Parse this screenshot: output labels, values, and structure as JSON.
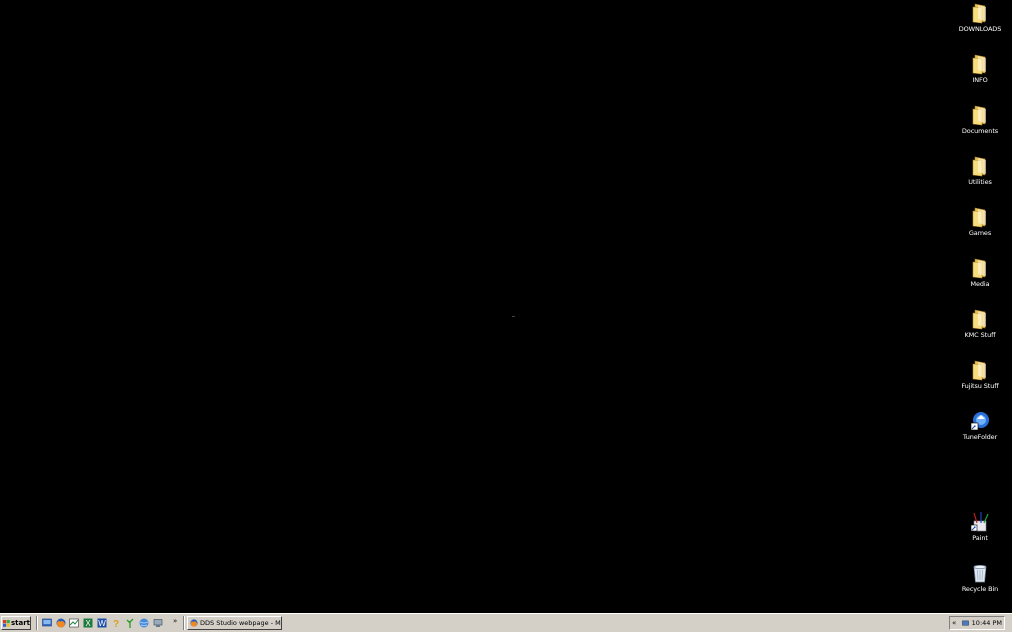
{
  "desktop": {
    "icons": [
      {
        "label": "DOWNLOADS",
        "icon": "folder-icon"
      },
      {
        "label": "INFO",
        "icon": "folder-icon"
      },
      {
        "label": "Documents",
        "icon": "folder-icon"
      },
      {
        "label": "Utilities",
        "icon": "folder-icon"
      },
      {
        "label": "Games",
        "icon": "folder-icon"
      },
      {
        "label": "Media",
        "icon": "folder-icon"
      },
      {
        "label": "KMC Stuff",
        "icon": "folder-icon"
      },
      {
        "label": "Fujitsu Stuff",
        "icon": "folder-icon"
      },
      {
        "label": "TuneFolder",
        "icon": "tune-app-icon"
      },
      {
        "label": "Paint",
        "icon": "paint-icon"
      },
      {
        "label": "Recycle Bin",
        "icon": "recycle-bin-icon"
      }
    ]
  },
  "taskbar": {
    "start_label": "start",
    "quick_launch": [
      "show-desktop-icon",
      "firefox-icon",
      "media-icon",
      "excel-icon",
      "word-icon",
      "help-icon",
      "plant-icon",
      "globe-icon",
      "computer-icon"
    ],
    "overflow_label": "»",
    "task_label": "DDS Studio webpage - M...",
    "tray_chevron": "«",
    "clock": "10:44 PM"
  },
  "colors": {
    "desktop_bg": "#000000",
    "taskbar_bg": "#d4d0c8",
    "folder": "#f5d774"
  }
}
